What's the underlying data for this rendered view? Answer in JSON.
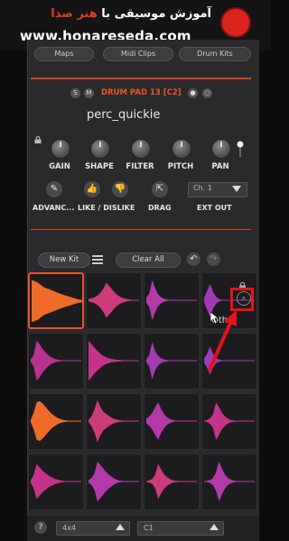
{
  "banner": {
    "title_prefix": "آموزش موسیقی با",
    "title_brand": "هنر صدا",
    "url": "www.honareseda.com"
  },
  "top_tabs": [
    "Maps",
    "Midi Clips",
    "Drum Kits"
  ],
  "header": {
    "buttons": [
      "S",
      "M"
    ],
    "pad_title": "DRUM PAD 13 [C2]",
    "preset_name": "perc_quickie"
  },
  "knobs": [
    "GAIN",
    "SHAPE",
    "FILTER",
    "PITCH",
    "PAN"
  ],
  "controls": {
    "advanced_label": "ADVANC...",
    "like_label": "LIKE / DISLIKE",
    "drag_label": "DRAG",
    "ext_out_label": "EXT OUT",
    "channel_value": "Ch. 1"
  },
  "kit_toolbar": {
    "new_kit": "New Kit",
    "clear_all": "Clear All"
  },
  "pads": [
    {
      "color": "#ef6b2a",
      "selected": true,
      "label": ""
    },
    {
      "color": "#cc3b7a",
      "selected": false,
      "label": ""
    },
    {
      "color": "#b23aa9",
      "selected": false,
      "label": ""
    },
    {
      "color": "#a23ab6",
      "selected": false,
      "label": "Other"
    },
    {
      "color": "#b83290",
      "selected": false,
      "label": ""
    },
    {
      "color": "#c5338a",
      "selected": false,
      "label": ""
    },
    {
      "color": "#a63ab2",
      "selected": false,
      "label": ""
    },
    {
      "color": "#9d3bb8",
      "selected": false,
      "label": ""
    },
    {
      "color": "#ef6b2a",
      "selected": false,
      "label": ""
    },
    {
      "color": "#cc3b7a",
      "selected": false,
      "label": ""
    },
    {
      "color": "#b23aa9",
      "selected": false,
      "label": ""
    },
    {
      "color": "#c5338a",
      "selected": false,
      "label": ""
    },
    {
      "color": "#c5338a",
      "selected": false,
      "label": ""
    },
    {
      "color": "#b23aa9",
      "selected": false,
      "label": ""
    },
    {
      "color": "#cc3b7a",
      "selected": false,
      "label": ""
    },
    {
      "color": "#b23aa9",
      "selected": false,
      "label": ""
    }
  ],
  "bottom_bar": {
    "help": "?",
    "grid_value": "4x4",
    "note_value": "C1"
  },
  "colors": {
    "accent": "#e8552a",
    "highlight": "#e4131a"
  }
}
